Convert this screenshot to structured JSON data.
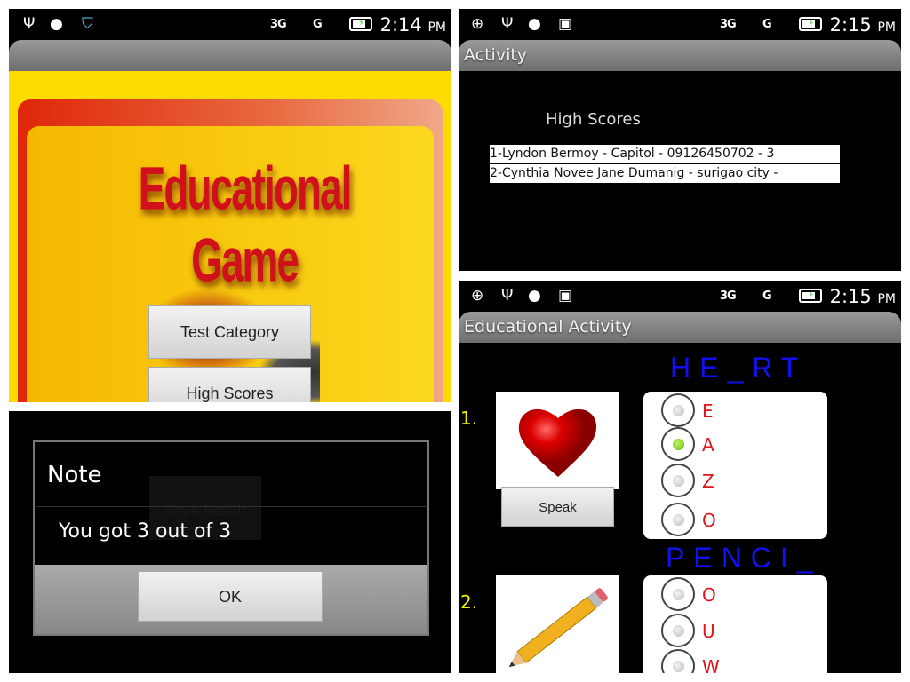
{
  "screens": {
    "home": {
      "time": "2:14",
      "ampm": "PM",
      "network": "3G",
      "signal": "G",
      "title_logo": "Educational Game",
      "buttons": [
        "Test Category",
        "High Scores"
      ],
      "status_icons": [
        "usb-icon",
        "android-icon",
        "shield-icon"
      ]
    },
    "scores": {
      "time": "2:15",
      "ampm": "PM",
      "network": "3G",
      "signal": "G",
      "action_title": "Activity",
      "heading": "High Scores",
      "rows": [
        "1-Lyndon Bermoy - Capitol - 09126450702 - 3",
        "2-Cynthia Novee Jane Dumanig - surigao city -"
      ]
    },
    "dialog": {
      "title": "Note",
      "message": "You got 3 out of 3",
      "ok": "OK",
      "behind_button": "Save Result"
    },
    "quiz": {
      "time": "2:15",
      "ampm": "PM",
      "network": "3G",
      "signal": "G",
      "action_title": "Educational Activity",
      "speak": "Speak",
      "questions": [
        {
          "number": "1.",
          "word": "HE_RT",
          "image": "heart",
          "options": [
            "E",
            "A",
            "Z",
            "O"
          ],
          "selected": 1
        },
        {
          "number": "2.",
          "word": "PENCI_",
          "image": "pencil",
          "options": [
            "O",
            "U",
            "W"
          ],
          "selected": null
        }
      ]
    }
  },
  "colors": {
    "selected_radio": "#5bbf12",
    "word": "#1010f0",
    "option": "#e0141a",
    "number": "#f0f000",
    "logo": "#d0101a",
    "home_bg": "#f7c600"
  }
}
